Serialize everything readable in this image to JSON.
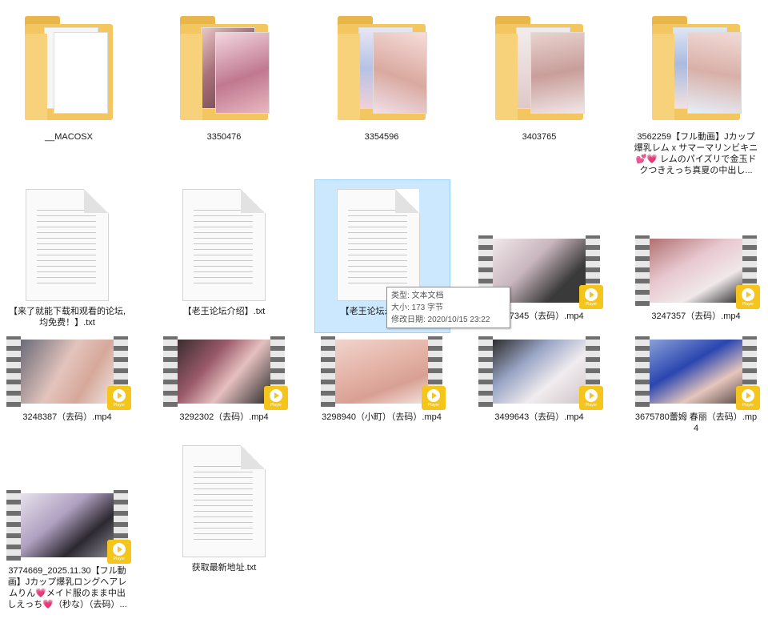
{
  "folders": [
    {
      "label": "__MACOSX"
    },
    {
      "label": "3350476"
    },
    {
      "label": "3354596"
    },
    {
      "label": "3403765"
    },
    {
      "label": "3562259【フル動画】Jカップ爆乳レム x サマーマリンビキニ💕💗 レムのパイズリで金玉ドクつきえっち真夏の中出し..."
    }
  ],
  "documents": [
    {
      "label": "【来了就能下载和观看的论坛,均免费！】.txt"
    },
    {
      "label": "【老王论坛介绍】.txt"
    },
    {
      "label": "【老王论坛永久..txt"
    }
  ],
  "tooltip": {
    "type": "类型: 文本文档",
    "size": "大小: 173 字节",
    "modified": "修改日期: 2020/10/15 23:22"
  },
  "videos": [
    {
      "label": "3247345（去码）.mp4"
    },
    {
      "label": "3247357（去码）.mp4"
    },
    {
      "label": "3248387（去码）.mp4"
    },
    {
      "label": "3292302（去码）.mp4"
    },
    {
      "label": "3298940（小町）（去码）.mp4"
    },
    {
      "label": "3499643（去码）.mp4"
    },
    {
      "label": "3675780蕾姆 春丽（去码）.mp4"
    },
    {
      "label": "3774669_2025.11.30【フル動画】Jカップ爆乳ロングヘアレムりん💗メイド服のまま中出しえっち💗（秒な）（去码）..."
    }
  ],
  "document_last": {
    "label": "获取最新地址.txt"
  },
  "badge_text": "Player",
  "colors": {
    "folder": "#f3c660",
    "selection": "#cce8ff",
    "badge": "#f6c51b"
  }
}
